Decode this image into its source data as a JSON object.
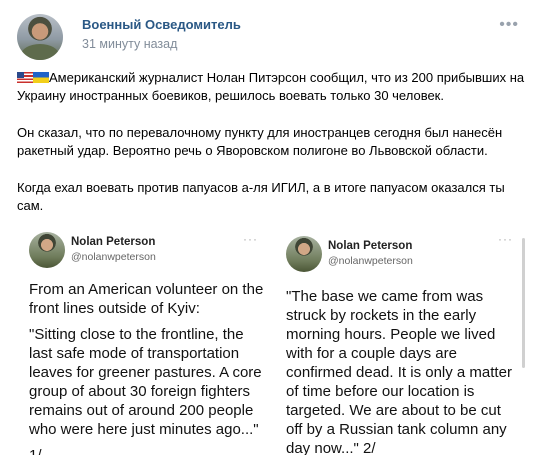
{
  "post": {
    "author": "Военный Осведомитель",
    "time": "31 минуту назад",
    "more_icon": "ellipsis-icon",
    "flags": [
      "us-flag-icon",
      "ukraine-flag-icon"
    ],
    "paragraphs": [
      "Американский журналист Нолан Питэрсон сообщил, что из 200 прибывших на Украину иностранных боевиков, решилось воевать только 30 человек.",
      "Он сказал, что по перевалочному пункту для иностранцев сегодня был нанесён ракетный удар. Вероятно речь о Яворовском полигоне во Львовской области.",
      "Когда ехал воевать против папуасов а-ля ИГИЛ, а в итоге папуасом оказался ты сам."
    ]
  },
  "tweets": [
    {
      "name": "Nolan Peterson",
      "handle": "@nolanwpeterson",
      "p1": "From an American volunteer on the front lines outside of Kyiv:",
      "p2": "\"Sitting close to the frontline, the last safe mode of transportation leaves for greener pastures. A core group of about 30 foreign fighters remains out of around 200 people who were here just minutes ago...\"",
      "p3": "1/"
    },
    {
      "name": "Nolan Peterson",
      "handle": "@nolanwpeterson",
      "p1": "\"The base we came from was struck by rockets in the early morning hours. People we lived with for a couple days are confirmed dead. It is only a matter of time before our location is targeted. We are about to be cut off by a Russian tank column any day now...\" 2/"
    }
  ]
}
